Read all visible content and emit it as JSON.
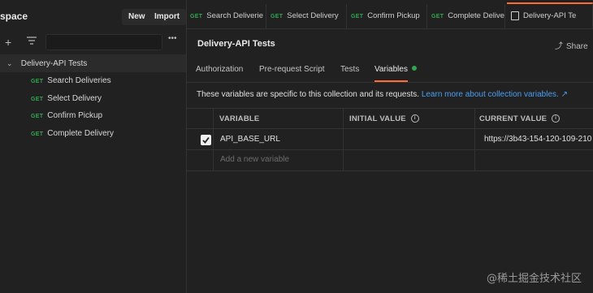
{
  "sidebar": {
    "workspace_title": "space",
    "new_label": "New",
    "import_label": "Import",
    "collection_name": "Delivery-API Tests",
    "requests": [
      {
        "method": "GET",
        "name": "Search Deliveries"
      },
      {
        "method": "GET",
        "name": "Select Delivery"
      },
      {
        "method": "GET",
        "name": "Confirm Pickup"
      },
      {
        "method": "GET",
        "name": "Complete Delivery"
      }
    ]
  },
  "tabs": [
    {
      "method": "GET",
      "name": "Search Deliverie"
    },
    {
      "method": "GET",
      "name": "Select Delivery"
    },
    {
      "method": "GET",
      "name": "Confirm Pickup"
    },
    {
      "method": "GET",
      "name": "Complete Delive"
    },
    {
      "method": "",
      "name": "Delivery-API Te"
    }
  ],
  "main": {
    "title": "Delivery-API Tests",
    "share_label": "Share",
    "subtabs": [
      "Authorization",
      "Pre-request Script",
      "Tests",
      "Variables"
    ],
    "info_text": "These variables are specific to this collection and its requests.",
    "info_link": "Learn more about collection variables. ↗",
    "columns": [
      "VARIABLE",
      "INITIAL VALUE",
      "CURRENT VALUE"
    ],
    "rows": [
      {
        "variable": "API_BASE_URL",
        "initial": "",
        "current": "https://3b43-154-120-109-210"
      }
    ],
    "add_placeholder": "Add a new variable"
  },
  "watermark": "@稀土掘金技术社区",
  "colors": {
    "accent": "#ff6c37",
    "get": "#2fa74f",
    "link": "#4a9ff5",
    "active_dot": "#2fa74f"
  }
}
